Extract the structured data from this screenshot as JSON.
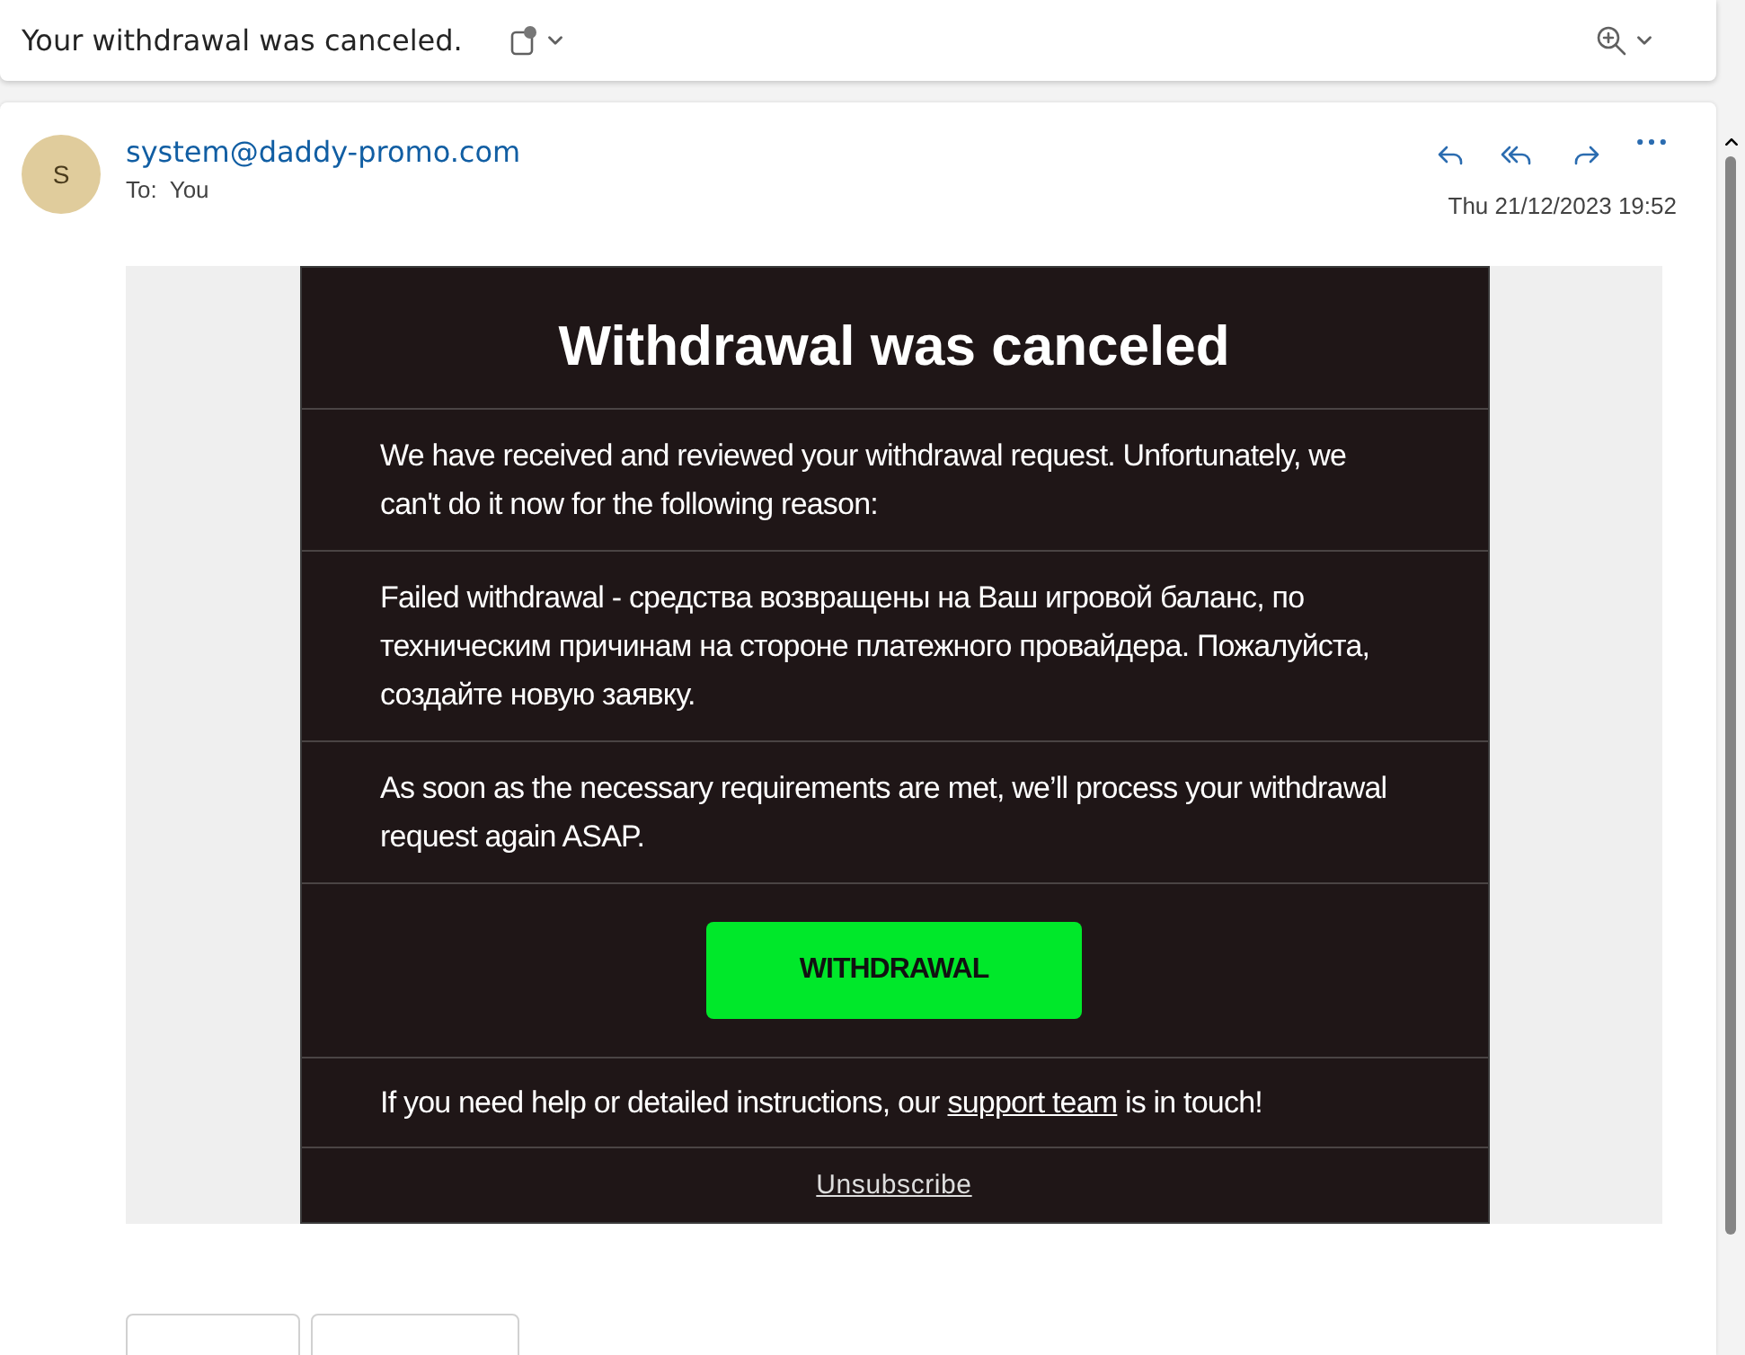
{
  "subject": "Your withdrawal was canceled.",
  "sender": {
    "initial": "S",
    "address": "system@daddy-promo.com",
    "to_label": "To:",
    "to": "You",
    "date": "Thu 21/12/2023 19:52"
  },
  "body": {
    "title": "Withdrawal was canceled",
    "sections": [
      {
        "kind": "text",
        "text": "We have received and reviewed your withdrawal request. Unfortunately, we can't do it now for the following reason:"
      },
      {
        "kind": "text",
        "text": "Failed withdrawal - средства возвращены на Ваш игровой баланс, по техническим причинам на стороне платежного провайдера. Пожалуйста, создайте новую заявку."
      },
      {
        "kind": "text",
        "text": "As soon as the necessary requirements are met, we’ll process your withdrawal request again ASAP."
      },
      {
        "kind": "button",
        "text": "WITHDRAWAL"
      },
      {
        "kind": "help",
        "before": "If you need help or detailed instructions, our ",
        "link": "support team",
        "after": " is in touch!"
      },
      {
        "kind": "unsubscribe",
        "text": "Unsubscribe"
      }
    ]
  }
}
